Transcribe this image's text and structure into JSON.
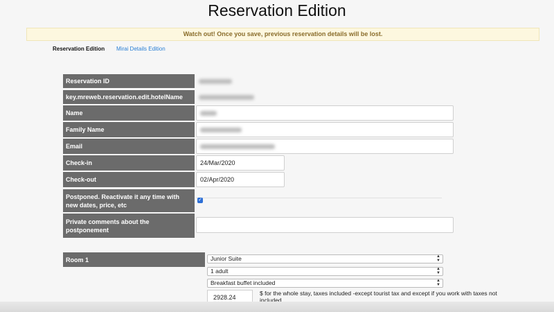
{
  "page": {
    "title": "Reservation Edition"
  },
  "alert": {
    "text": "Watch out! Once you save, previous reservation details will be lost."
  },
  "tabs": [
    {
      "label": "Reservation Edition",
      "active": true
    },
    {
      "label": "Mirai Details Edition",
      "active": false
    }
  ],
  "form": {
    "reservation_id": {
      "label": "Reservation ID"
    },
    "hotel_name": {
      "label": "key.mreweb.reservation.edit.hotelName"
    },
    "name": {
      "label": "Name"
    },
    "family_name": {
      "label": "Family Name"
    },
    "email": {
      "label": "Email"
    },
    "checkin": {
      "label": "Check-in",
      "value": "24/Mar/2020"
    },
    "checkout": {
      "label": "Check-out",
      "value": "02/Apr/2020"
    },
    "postponed": {
      "label": "Postponed. Reactivate it any time with new dates, price, etc",
      "checked": true
    },
    "comments": {
      "label": "Private comments about the postponement",
      "value": ""
    }
  },
  "room": {
    "label": "Room 1",
    "type": "Junior Suite",
    "occupancy": "1 adult",
    "board": "Breakfast buffet included",
    "price": "2928.24",
    "price_note": "$ for the whole stay, taxes included -except tourist tax and except if you work with taxes not included"
  },
  "colors": {
    "label_bg": "#6b6b6b",
    "alert_bg": "#fdf7df",
    "link": "#2a7fd4",
    "checkbox": "#2d6fd6"
  }
}
